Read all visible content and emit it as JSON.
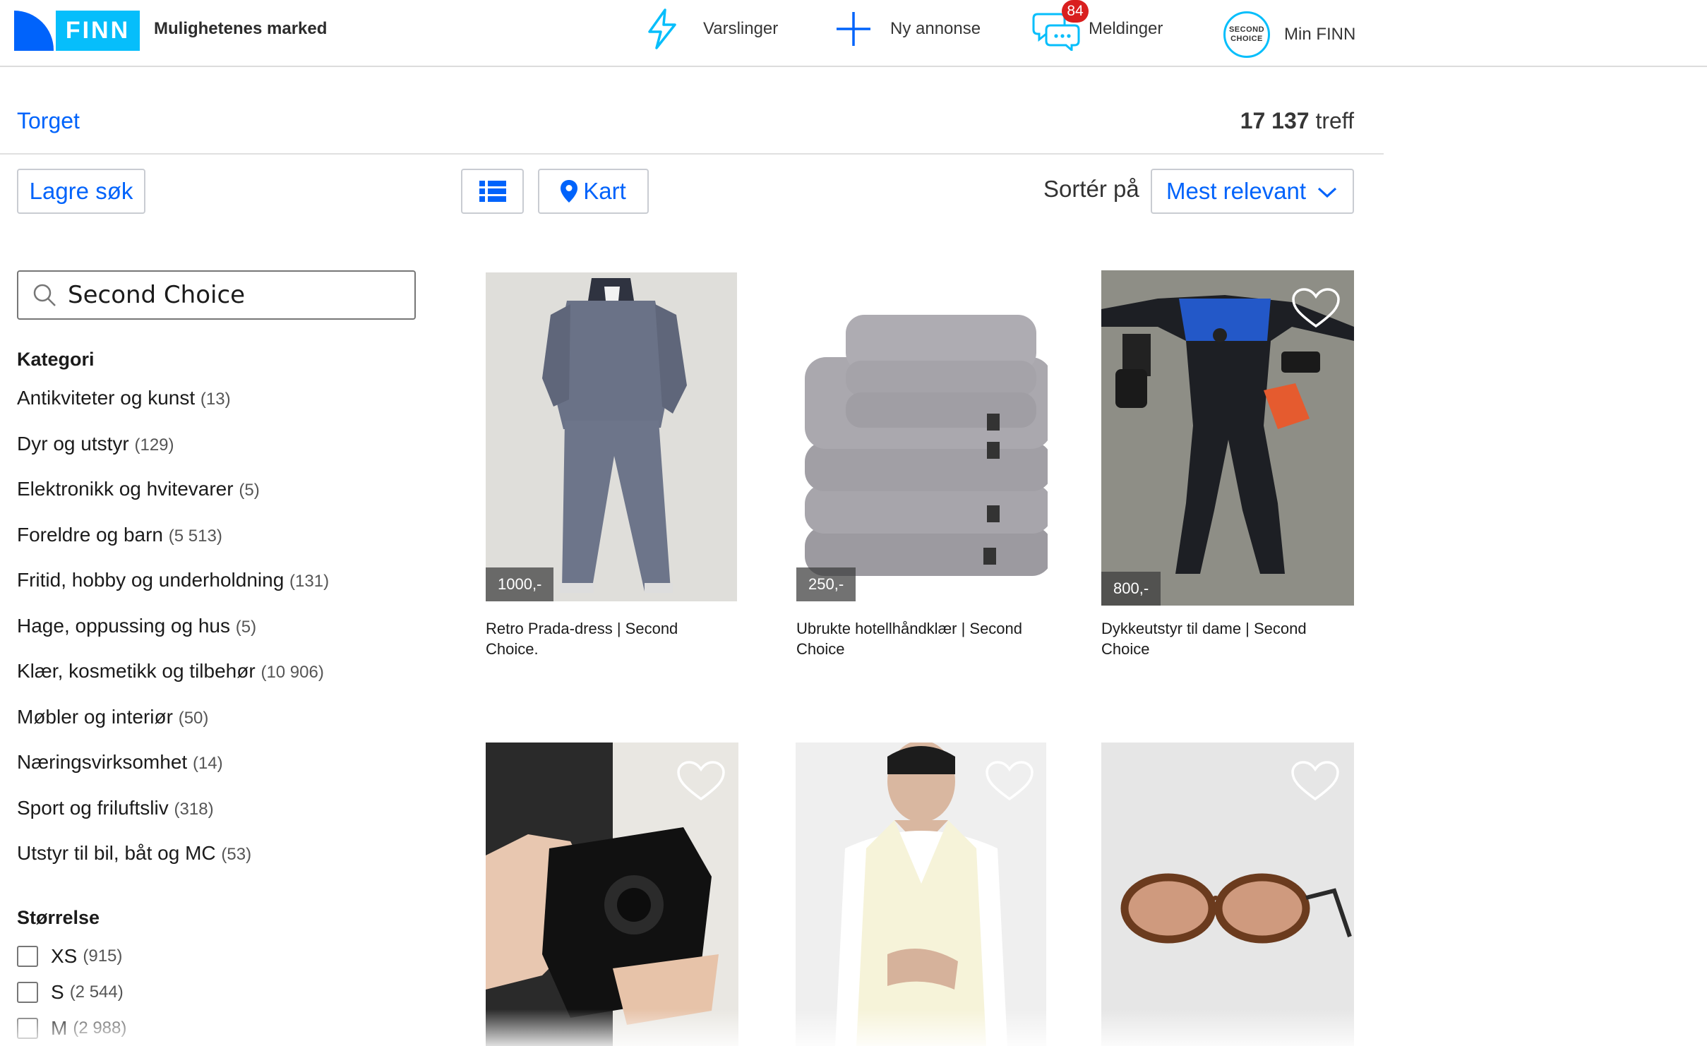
{
  "header": {
    "logo_text": "FINN",
    "tagline": "Mulighetenes marked",
    "nav": {
      "alerts": "Varslinger",
      "new_ad": "Ny annonse",
      "messages": "Meldinger",
      "messages_badge": "84",
      "profile": "Min FINN",
      "profile_logo_line1": "SECOND",
      "profile_logo_line2": "CHOICE"
    },
    "accent": "#0063fb",
    "brand_light": "#06befb",
    "badge_color": "#d91f1f"
  },
  "subheader": {
    "breadcrumb": "Torget",
    "hits_number": "17 137",
    "hits_label": " treff"
  },
  "toolbar": {
    "save_search": "Lagre søk",
    "map": "Kart",
    "sort_label": "Sortér på",
    "sort_value": "Mest relevant"
  },
  "sidebar": {
    "search_value": "Second Choice",
    "category_title": "Kategori",
    "categories": [
      {
        "label": "Antikviteter og kunst",
        "count": "(13)"
      },
      {
        "label": "Dyr og utstyr",
        "count": "(129)"
      },
      {
        "label": "Elektronikk og hvitevarer",
        "count": "(5)"
      },
      {
        "label": "Foreldre og barn",
        "count": "(5 513)"
      },
      {
        "label": "Fritid, hobby og underholdning",
        "count": "(131)"
      },
      {
        "label": "Hage, oppussing og hus",
        "count": "(5)"
      },
      {
        "label": "Klær, kosmetikk og tilbehør",
        "count": "(10 906)"
      },
      {
        "label": "Møbler og interiør",
        "count": "(50)"
      },
      {
        "label": "Næringsvirksomhet",
        "count": "(14)"
      },
      {
        "label": "Sport og friluftsliv",
        "count": "(318)"
      },
      {
        "label": "Utstyr til bil, båt og MC",
        "count": "(53)"
      }
    ],
    "size_title": "Størrelse",
    "sizes": [
      {
        "label": "XS",
        "count": "(915)"
      },
      {
        "label": "S",
        "count": "(2 544)"
      },
      {
        "label": "M",
        "count": "(2 988)"
      }
    ]
  },
  "listings": [
    {
      "title_line1": "Retro Prada-dress | Second",
      "title_line2": "Choice.",
      "price": "1000,-"
    },
    {
      "title_line1": "Ubrukte hotellhåndklær | Second",
      "title_line2": "Choice",
      "price": "250,-"
    },
    {
      "title_line1": "Dykkeutstyr til dame | Second",
      "title_line2": "Choice",
      "price": "800,-"
    },
    {
      "title_line1": "",
      "title_line2": "",
      "price": ""
    },
    {
      "title_line1": "",
      "title_line2": "",
      "price": ""
    },
    {
      "title_line1": "",
      "title_line2": "",
      "price": ""
    }
  ],
  "image_icons": [
    "suit-photo",
    "towels-photo",
    "wetsuit-photo",
    "camera-photo",
    "vest-photo",
    "sunglasses-photo"
  ]
}
